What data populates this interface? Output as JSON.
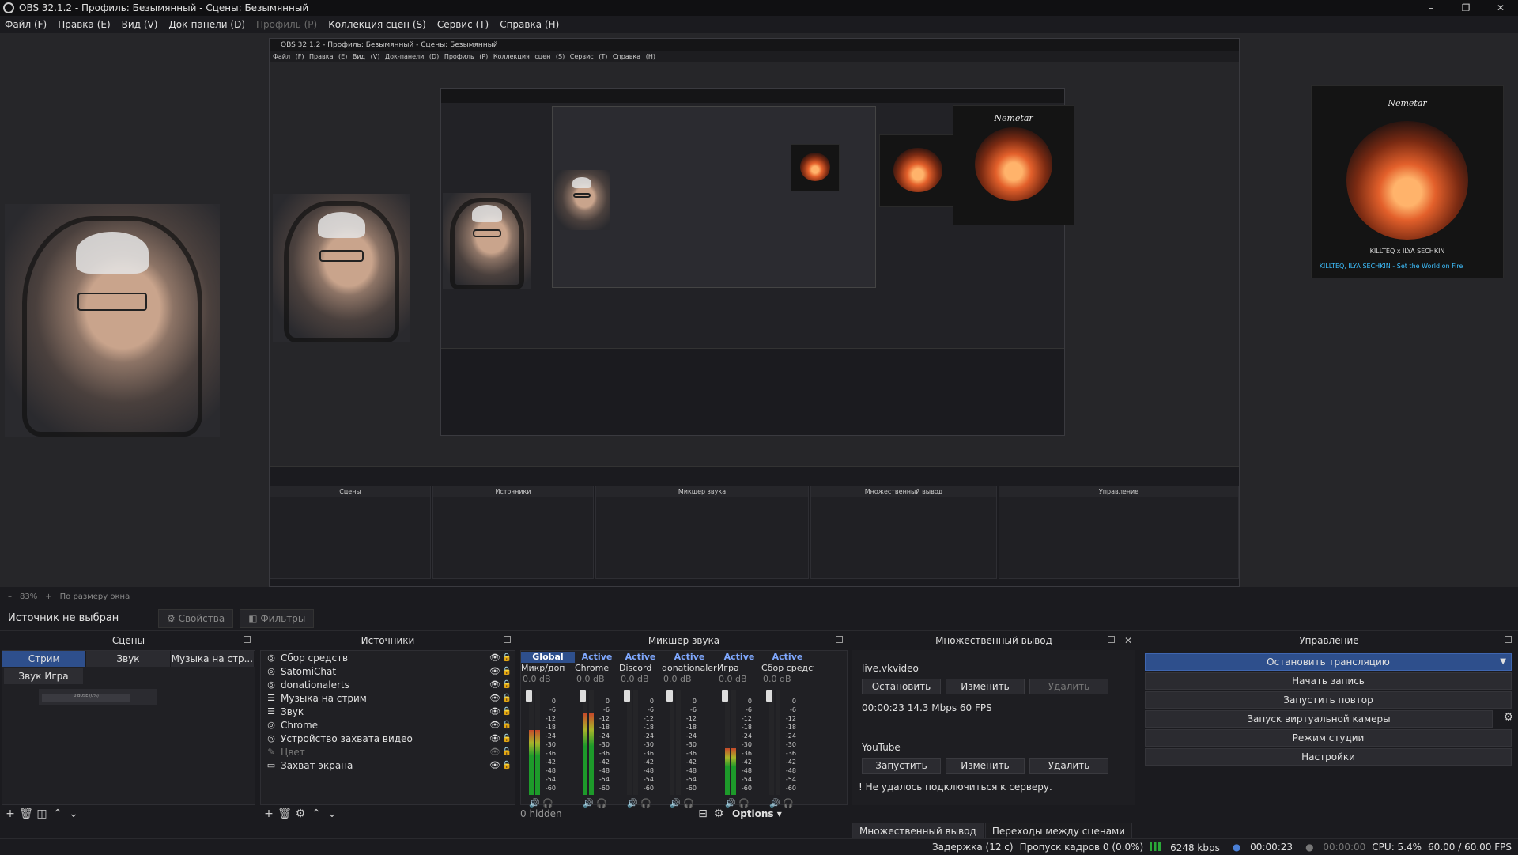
{
  "window": {
    "title": "OBS 32.1.2 - Профиль: Безымянный - Сцены: Безымянный",
    "controls": [
      "–",
      "❐",
      "✕"
    ]
  },
  "menu": [
    {
      "label": "Файл (F)",
      "disabled": false
    },
    {
      "label": "Правка (E)",
      "disabled": false
    },
    {
      "label": "Вид (V)",
      "disabled": false
    },
    {
      "label": "Док-панели (D)",
      "disabled": false
    },
    {
      "label": "Профиль (P)",
      "disabled": true
    },
    {
      "label": "Коллекция сцен (S)",
      "disabled": false
    },
    {
      "label": "Сервис (T)",
      "disabled": false
    },
    {
      "label": "Справка (H)",
      "disabled": false
    }
  ],
  "preview": {
    "album_logo": "Nemetar",
    "album_caption": "KILLTEQ x ILYA SECHKIN",
    "album_track": "KILLTEQ, ILYA SECHKIN - Set the World on Fire",
    "nested_title": "OBS 32.1.2 - Профиль: Безымянный - Сцены: Безымянный",
    "nested_menu": "Файл (F) Правка (E) Вид (V) Док-панели (D) Профиль (P) Коллекция сцен (S) Сервис (T) Справка (H)"
  },
  "zoom": {
    "minus": "–",
    "value": "83%",
    "plus": "+",
    "fit": "По размеру окна"
  },
  "source_bar": {
    "no_source": "Источник не выбран",
    "properties": "Свойства",
    "filters": "Фильтры"
  },
  "scenes": {
    "title": "Сцены",
    "tabs": [
      "Стрим",
      "Звук",
      "Музыка на стр..."
    ],
    "items": [
      "Звук Игра"
    ],
    "thumb_label": "0 BUSE (0%)"
  },
  "sources": {
    "title": "Источники",
    "items": [
      {
        "label": "Сбор средств",
        "icon": "obs-icon",
        "dim": false
      },
      {
        "label": "SatomiChat",
        "icon": "obs-icon",
        "dim": false
      },
      {
        "label": "donationalerts",
        "icon": "obs-icon",
        "dim": false
      },
      {
        "label": "Музыка на стрим",
        "icon": "list-icon",
        "dim": false
      },
      {
        "label": "Звук",
        "icon": "list-icon",
        "dim": false
      },
      {
        "label": "Chrome",
        "icon": "browser-icon",
        "dim": false
      },
      {
        "label": "Устройство захвата видео",
        "icon": "camera-icon",
        "dim": false
      },
      {
        "label": "Цвет",
        "icon": "brush-icon",
        "dim": true
      },
      {
        "label": "Захват экрана",
        "icon": "monitor-icon",
        "dim": false
      }
    ]
  },
  "mixer": {
    "title": "Микшер звука",
    "headers": [
      "Global",
      "Active",
      "Active",
      "Active",
      "Active",
      "Active"
    ],
    "channels": [
      {
        "name": "Микр/доп",
        "db": "0.0 dB",
        "level": 0.62
      },
      {
        "name": "Chrome",
        "db": "0.0 dB",
        "level": 0.78
      },
      {
        "name": "Discord",
        "db": "0.0 dB",
        "level": 0.0
      },
      {
        "name": "donationalerts",
        "db": "0.0 dB",
        "level": 0.0
      },
      {
        "name": "Игра",
        "db": "0.0 dB",
        "level": 0.45
      },
      {
        "name": "Сбор средств",
        "db": "0.0 dB",
        "level": 0.0
      }
    ],
    "scale": [
      "0",
      "-6",
      "-12",
      "-18",
      "-24",
      "-30",
      "-36",
      "-42",
      "-48",
      "-54",
      "-60"
    ],
    "hidden": "0 hidden",
    "options": "Options"
  },
  "multi_output": {
    "title": "Множественный вывод",
    "targets": [
      {
        "name": "live.vkvideo",
        "buttons": [
          {
            "label": "Остановить",
            "disabled": false
          },
          {
            "label": "Изменить",
            "disabled": false
          },
          {
            "label": "Удалить",
            "disabled": true
          }
        ],
        "stats": "00:00:23  14.3 Mbps  60 FPS"
      },
      {
        "name": "YouTube",
        "buttons": [
          {
            "label": "Запустить",
            "disabled": false
          },
          {
            "label": "Изменить",
            "disabled": false
          },
          {
            "label": "Удалить",
            "disabled": false
          }
        ],
        "stats": ""
      }
    ],
    "error": "Не удалось подключиться к серверу."
  },
  "bottom_tabs": [
    "Множественный вывод",
    "Переходы между сценами"
  ],
  "controls": {
    "title": "Управление",
    "buttons": [
      {
        "label": "Остановить трансляцию",
        "active": true
      },
      {
        "label": "Начать запись",
        "active": false
      },
      {
        "label": "Запустить повтор",
        "active": false
      },
      {
        "label": "Запуск виртуальной камеры",
        "active": false
      },
      {
        "label": "Режим студии",
        "active": false
      },
      {
        "label": "Настройки",
        "active": false
      }
    ]
  },
  "status": {
    "delay": "Задержка (12 с)",
    "dropped": "Пропуск кадров 0 (0.0%)",
    "bitrate": "6248 kbps",
    "stream_time": "00:00:23",
    "rec_time": "00:00:00",
    "cpu": "CPU: 5.4%",
    "fps": "60.00 / 60.00 FPS"
  }
}
